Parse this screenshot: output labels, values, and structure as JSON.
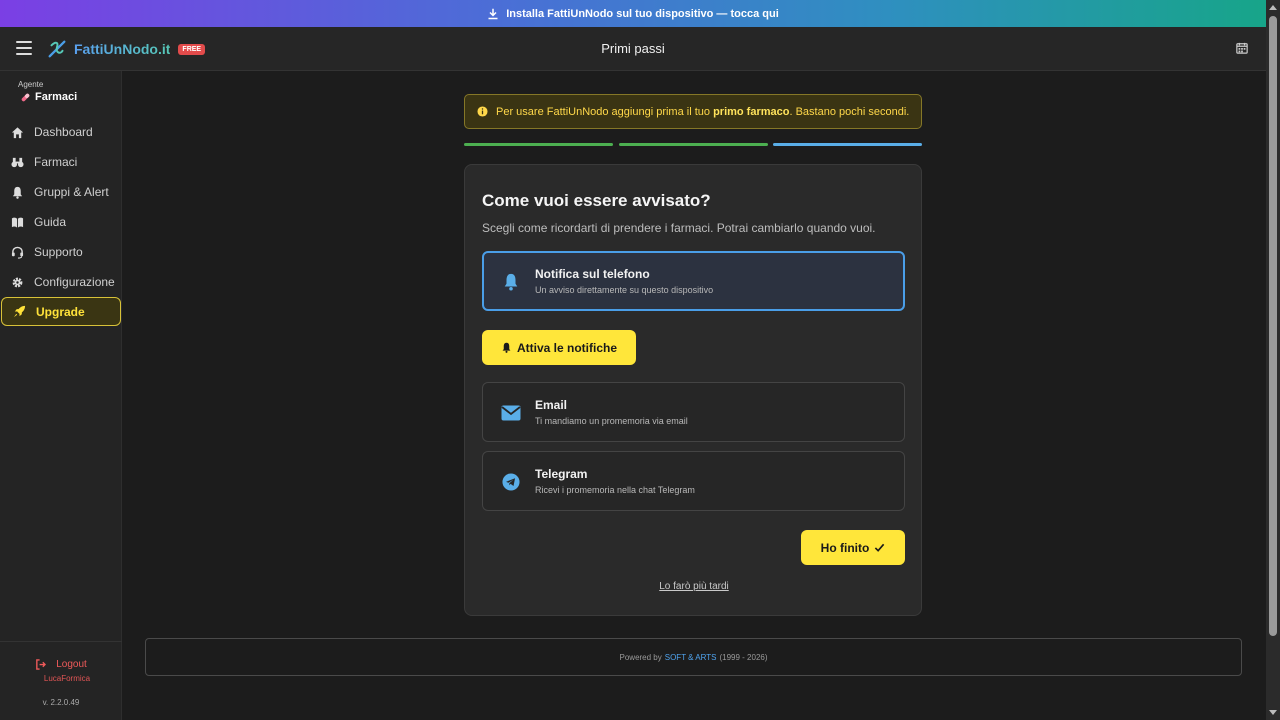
{
  "banner": {
    "text": "Installa FattiUnNodo sul tuo dispositivo — tocca qui"
  },
  "header": {
    "logo": "FattiUnNodo.it",
    "badge": "FREE",
    "title": "Primi passi"
  },
  "sidebar": {
    "agent_label": "Agente",
    "agent_name": "Farmaci",
    "items": [
      {
        "label": "Dashboard",
        "icon": "home-icon"
      },
      {
        "label": "Farmaci",
        "icon": "binoculars-icon"
      },
      {
        "label": "Gruppi & Alert",
        "icon": "bell-icon"
      },
      {
        "label": "Guida",
        "icon": "book-icon"
      },
      {
        "label": "Supporto",
        "icon": "headset-icon"
      },
      {
        "label": "Configurazione",
        "icon": "gear-icon"
      },
      {
        "label": "Upgrade",
        "icon": "rocket-icon"
      }
    ],
    "logout": "Logout",
    "username": "LucaFormica",
    "version": "v. 2.2.0.49"
  },
  "alert": {
    "before": "Per usare FattiUnNodo aggiungi prima il tuo ",
    "bold": "primo farmaco",
    "after": ". Bastano pochi secondi."
  },
  "progress": {
    "steps_done": 2,
    "current_step": 3,
    "total_steps": 3,
    "colors": {
      "done": "#4caf50",
      "current": "#5aaee8"
    }
  },
  "card": {
    "title": "Come vuoi essere avvisato?",
    "subtitle": "Scegli come ricordarti di prendere i farmaci. Potrai cambiarlo quando vuoi.",
    "options": [
      {
        "title": "Notifica sul telefono",
        "desc": "Un avviso direttamente su questo dispositivo",
        "icon": "bell-icon",
        "selected": true
      },
      {
        "title": "Email",
        "desc": "Ti mandiamo un promemoria via email",
        "icon": "envelope-icon",
        "selected": false
      },
      {
        "title": "Telegram",
        "desc": "Ricevi i promemoria nella chat Telegram",
        "icon": "telegram-icon",
        "selected": false
      }
    ],
    "enable_button": "Attiva le notifiche",
    "done_button": "Ho finito",
    "later_link": "Lo farò più tardi"
  },
  "footer": {
    "prefix": "Powered by",
    "brand": "SOFT & ARTS",
    "years": "(1999 - 2026)"
  },
  "colors": {
    "accent_yellow": "#ffe63a",
    "accent_blue": "#4a9ee8",
    "danger": "#ef5a5a"
  }
}
